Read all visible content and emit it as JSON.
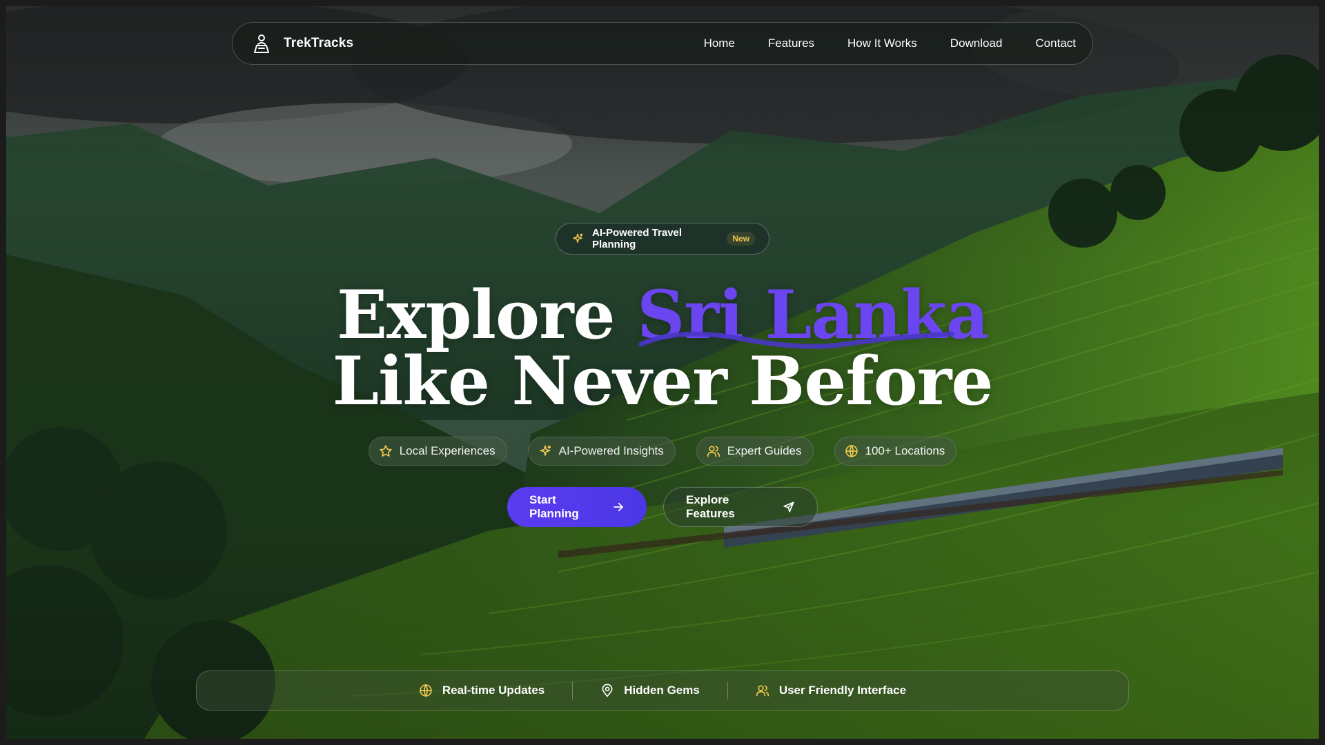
{
  "brand": {
    "name": "TrekTracks",
    "icon": "map-pin-person-icon"
  },
  "nav": {
    "links": [
      "Home",
      "Features",
      "How It Works",
      "Download",
      "Contact"
    ]
  },
  "badge": {
    "text": "AI-Powered Travel Planning",
    "tag": "New",
    "icon": "sparkles-icon"
  },
  "hero": {
    "line1_prefix": "Explore ",
    "line1_accent": "Sri Lanka",
    "line2": "Like Never Before"
  },
  "chips": [
    {
      "label": "Local Experiences",
      "icon": "star-icon"
    },
    {
      "label": "AI-Powered Insights",
      "icon": "sparkles-icon"
    },
    {
      "label": "Expert Guides",
      "icon": "users-icon"
    },
    {
      "label": "100+ Locations",
      "icon": "globe-icon"
    }
  ],
  "cta": {
    "primary": "Start Planning",
    "secondary": "Explore Features"
  },
  "bottom_bar": [
    {
      "label": "Real-time Updates",
      "icon": "globe-icon"
    },
    {
      "label": "Hidden Gems",
      "icon": "map-pin-icon"
    },
    {
      "label": "User Friendly Interface",
      "icon": "users-icon"
    }
  ],
  "colors": {
    "accent": "#6a45f0",
    "icon_yellow": "#f2c94c"
  }
}
